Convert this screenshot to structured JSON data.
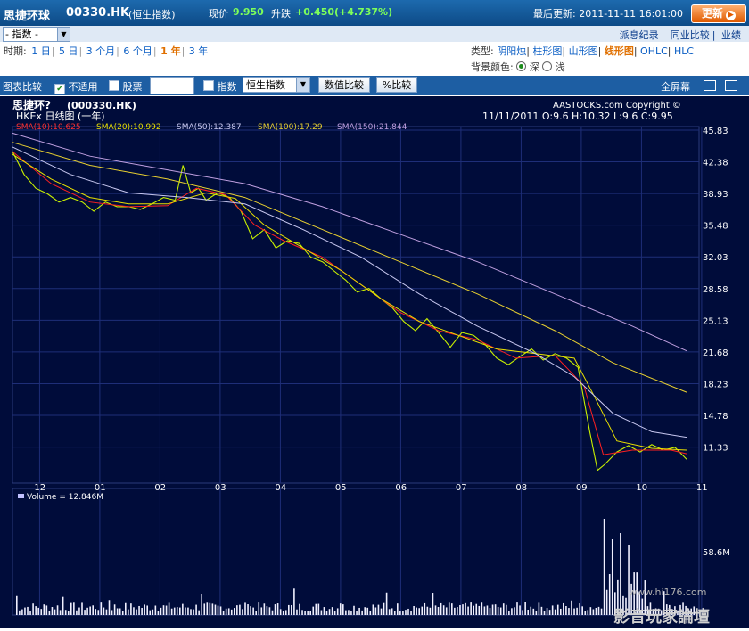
{
  "header": {
    "name": "思捷环球",
    "code": "00330.HK",
    "index": "(恒生指数)",
    "price_label": "现价",
    "price": "9.950",
    "change_label": "升跌",
    "change": "+0.450(+4.737%)",
    "update": "最后更新: 2011-11-11 16:01:00",
    "refresh_label": "更新"
  },
  "toolbar": {
    "selector_value": "- 指数 -",
    "links": [
      "派息纪录",
      "同业比较",
      "业绩"
    ],
    "period_label": "时期:",
    "periods": [
      "1 日",
      "5 日",
      "3 个月",
      "6 个月",
      "1 年",
      "3 年"
    ],
    "active_period": "1 年",
    "type_label": "类型:",
    "types": [
      "阴阳烛",
      "柱形图",
      "山形图",
      "线形图",
      "OHLC",
      "HLC"
    ],
    "active_type": "线形图",
    "bg_label": "背景颜色:",
    "bg_options": [
      "深",
      "浅"
    ],
    "compare_label": "图表比较",
    "not_applicable": "不适用",
    "stocks": "股票",
    "index": "指数",
    "index_select": "恒生指数",
    "value_compare": "数值比较",
    "pct_compare": "%比较",
    "fullscreen": "全屏幕"
  },
  "chart": {
    "title": "思捷环?",
    "symbol": "(000330.HK)",
    "subtitle": "HKEx  日线图 (一年)",
    "copyright": "AASTOCKS.com Copyright ©",
    "ohlc": "11/11/2011  O:9.6  H:10.32  L:9.6  C:9.95",
    "sma_labels": [
      "SMA(10):10.625",
      "SMA(20):10.992",
      "SMA(50):12.387",
      "SMA(100):17.29",
      "SMA(150):21.844"
    ],
    "volume_label": "Volume  = 12.846M",
    "volume_tick": "58.6M",
    "watermark": "影音玩家論壇",
    "watermark_url": "www.hi176.com"
  },
  "colors": {
    "price": "#c8f000",
    "sma10": "#ff2020",
    "sma20": "#e8e000",
    "sma50": "#c8c8f0",
    "sma100": "#e8d030",
    "sma150": "#c0a0e0",
    "volume": "#f0f0ff"
  },
  "chart_data": {
    "type": "line",
    "ylim": [
      7.8,
      45.83
    ],
    "y_ticks": [
      45.83,
      42.38,
      38.93,
      35.48,
      32.03,
      28.58,
      25.13,
      21.68,
      18.23,
      14.78,
      11.33
    ],
    "x_ticks": [
      "12",
      "01",
      "02",
      "03",
      "04",
      "05",
      "06",
      "07",
      "08",
      "09",
      "10",
      "11"
    ],
    "series": [
      {
        "name": "Price",
        "points": [
          [
            0,
            43.5
          ],
          [
            6,
            41
          ],
          [
            12,
            39.5
          ],
          [
            18,
            38.9
          ],
          [
            24,
            38
          ],
          [
            30,
            38.5
          ],
          [
            36,
            38
          ],
          [
            42,
            37
          ],
          [
            48,
            38
          ],
          [
            54,
            37.5
          ],
          [
            60,
            37.5
          ],
          [
            66,
            37.2
          ],
          [
            72,
            37.8
          ],
          [
            78,
            38.5
          ],
          [
            84,
            38.2
          ],
          [
            88,
            42
          ],
          [
            92,
            39
          ],
          [
            96,
            39.5
          ],
          [
            100,
            38.2
          ],
          [
            106,
            39
          ],
          [
            112,
            38.5
          ],
          [
            118,
            37
          ],
          [
            124,
            34
          ],
          [
            130,
            35
          ],
          [
            136,
            33
          ],
          [
            142,
            33.8
          ],
          [
            148,
            33.5
          ],
          [
            154,
            32
          ],
          [
            160,
            31.5
          ],
          [
            166,
            30.5
          ],
          [
            172,
            29.5
          ],
          [
            178,
            28.2
          ],
          [
            184,
            28.6
          ],
          [
            190,
            27.5
          ],
          [
            196,
            26.5
          ],
          [
            202,
            25
          ],
          [
            208,
            24
          ],
          [
            214,
            25.3
          ],
          [
            220,
            23.8
          ],
          [
            226,
            22.2
          ],
          [
            232,
            23.8
          ],
          [
            238,
            23.5
          ],
          [
            244,
            22.5
          ],
          [
            250,
            21
          ],
          [
            256,
            20.3
          ],
          [
            262,
            21.2
          ],
          [
            268,
            22
          ],
          [
            274,
            20.8
          ],
          [
            280,
            21.5
          ],
          [
            286,
            21
          ],
          [
            292,
            20
          ],
          [
            298,
            13
          ],
          [
            302,
            8.8
          ],
          [
            306,
            9.5
          ],
          [
            312,
            10.8
          ],
          [
            318,
            11.5
          ],
          [
            324,
            10.8
          ],
          [
            330,
            11.6
          ],
          [
            336,
            11
          ],
          [
            342,
            11.3
          ],
          [
            348,
            10
          ]
        ]
      },
      {
        "name": "SMA(10)",
        "points": [
          [
            0,
            43.5
          ],
          [
            20,
            40
          ],
          [
            40,
            38
          ],
          [
            60,
            37.5
          ],
          [
            80,
            37.6
          ],
          [
            95,
            39.5
          ],
          [
            110,
            38.8
          ],
          [
            125,
            35.5
          ],
          [
            140,
            33.8
          ],
          [
            160,
            32
          ],
          [
            180,
            29
          ],
          [
            200,
            26
          ],
          [
            220,
            24
          ],
          [
            240,
            23
          ],
          [
            260,
            21
          ],
          [
            280,
            21.3
          ],
          [
            295,
            18
          ],
          [
            305,
            10.5
          ],
          [
            320,
            11
          ],
          [
            340,
            11
          ],
          [
            348,
            10.6
          ]
        ]
      },
      {
        "name": "SMA(20)",
        "points": [
          [
            0,
            43.2
          ],
          [
            20,
            40.5
          ],
          [
            40,
            38.5
          ],
          [
            60,
            37.8
          ],
          [
            80,
            37.8
          ],
          [
            100,
            39
          ],
          [
            115,
            38.4
          ],
          [
            130,
            35.5
          ],
          [
            150,
            33
          ],
          [
            170,
            30.5
          ],
          [
            190,
            27.5
          ],
          [
            210,
            25
          ],
          [
            230,
            23.5
          ],
          [
            250,
            22
          ],
          [
            270,
            21.5
          ],
          [
            290,
            21
          ],
          [
            300,
            17
          ],
          [
            312,
            12
          ],
          [
            330,
            11.2
          ],
          [
            348,
            11
          ]
        ]
      },
      {
        "name": "SMA(50)",
        "points": [
          [
            0,
            44
          ],
          [
            30,
            41
          ],
          [
            60,
            39
          ],
          [
            90,
            38.5
          ],
          [
            120,
            37.8
          ],
          [
            150,
            35
          ],
          [
            180,
            32
          ],
          [
            210,
            28
          ],
          [
            240,
            24.5
          ],
          [
            270,
            21.5
          ],
          [
            290,
            19
          ],
          [
            310,
            15
          ],
          [
            330,
            13
          ],
          [
            348,
            12.4
          ]
        ]
      },
      {
        "name": "SMA(100)",
        "points": [
          [
            0,
            44.5
          ],
          [
            40,
            42
          ],
          [
            80,
            40.5
          ],
          [
            120,
            38.5
          ],
          [
            160,
            35
          ],
          [
            200,
            31.5
          ],
          [
            240,
            28
          ],
          [
            280,
            24
          ],
          [
            310,
            20.5
          ],
          [
            348,
            17.3
          ]
        ]
      },
      {
        "name": "SMA(150)",
        "points": [
          [
            0,
            45.5
          ],
          [
            40,
            43
          ],
          [
            80,
            41.5
          ],
          [
            120,
            40
          ],
          [
            160,
            37.5
          ],
          [
            200,
            34.5
          ],
          [
            240,
            31.5
          ],
          [
            280,
            28
          ],
          [
            320,
            24.5
          ],
          [
            348,
            21.8
          ]
        ]
      }
    ]
  }
}
